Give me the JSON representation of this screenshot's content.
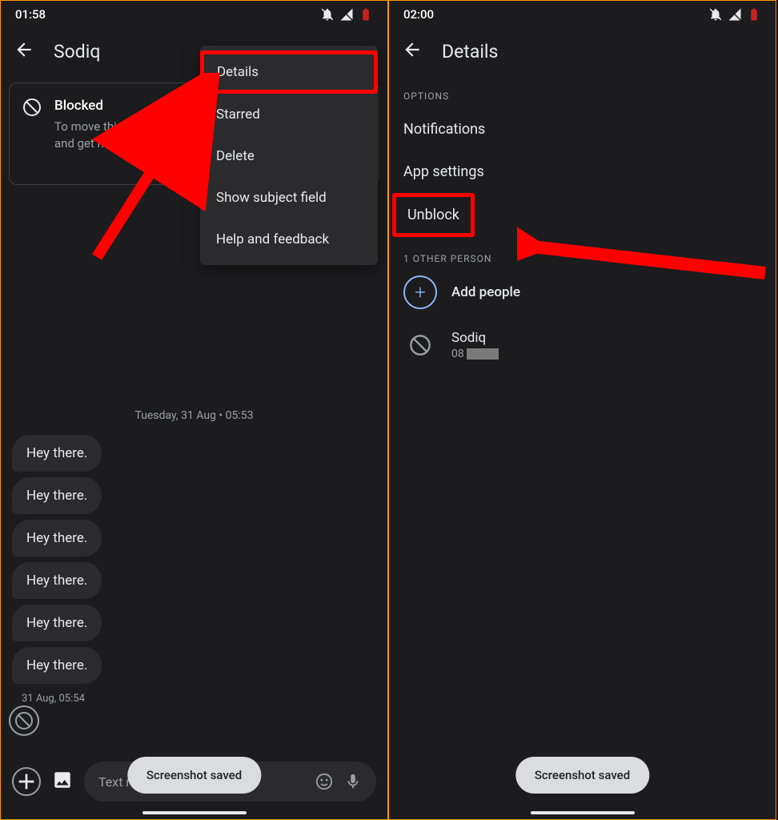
{
  "left": {
    "status_time": "01:58",
    "contact_name": "Sodiq",
    "blocked": {
      "title": "Blocked",
      "desc": "To move this conversation out of 'Archived and blocked' and get messages..."
    },
    "menu": {
      "details": "Details",
      "starred": "Starred",
      "delete": "Delete",
      "show_subject": "Show subject field",
      "help": "Help and feedback"
    },
    "timestamp": "Tuesday, 31 Aug • 05:53",
    "messages": [
      "Hey there.",
      "Hey there.",
      "Hey there.",
      "Hey there.",
      "Hey there.",
      "Hey there."
    ],
    "msg_time": "31 Aug, 05:54",
    "compose_placeholder": "Text message",
    "toast": "Screenshot saved"
  },
  "right": {
    "status_time": "02:00",
    "title": "Details",
    "section_options": "OPTIONS",
    "options": {
      "notifications": "Notifications",
      "app_settings": "App settings",
      "unblock": "Unblock"
    },
    "section_people": "1 OTHER PERSON",
    "add_people": "Add people",
    "person": {
      "name": "Sodiq",
      "number_prefix": "08"
    },
    "toast": "Screenshot saved"
  }
}
